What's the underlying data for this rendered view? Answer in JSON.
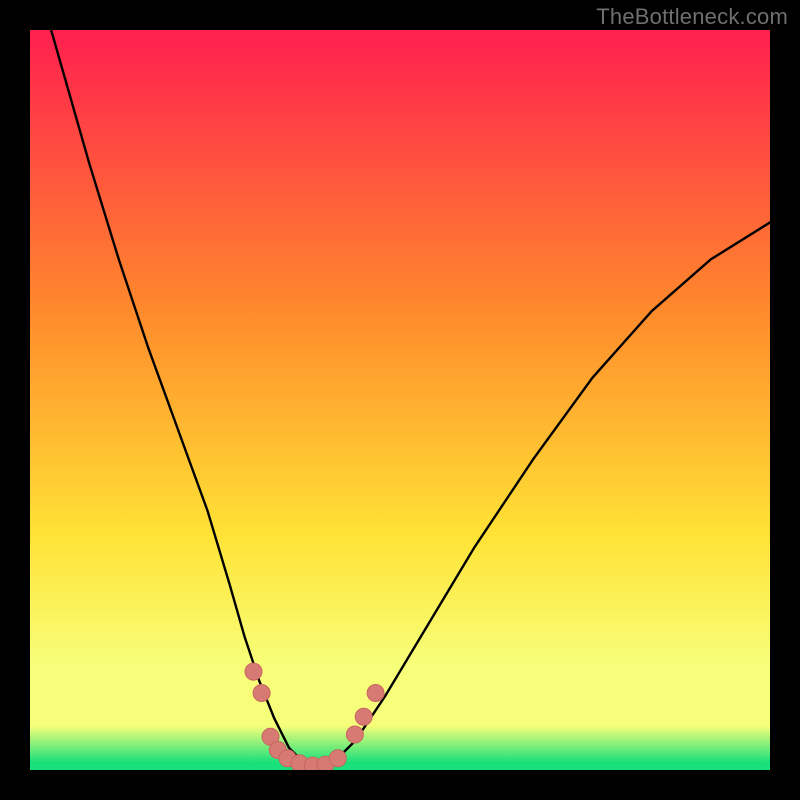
{
  "watermark": "TheBottleneck.com",
  "colors": {
    "bg": "#000000",
    "grad_top": "#ff1f4f",
    "grad_mid1": "#ff8a2b",
    "grad_mid2": "#ffe235",
    "grad_band": "#f7ff7a",
    "grad_bottom": "#18e07a",
    "curve": "#000000",
    "marker_fill": "#d77a74",
    "marker_stroke": "#c9655f"
  },
  "chart_data": {
    "type": "line",
    "title": "",
    "xlabel": "",
    "ylabel": "",
    "xlim": [
      0,
      100
    ],
    "ylim": [
      0,
      100
    ],
    "series": [
      {
        "name": "bottleneck-curve",
        "x": [
          0,
          4,
          8,
          12,
          16,
          20,
          24,
          27,
          29,
          31,
          33,
          35,
          37,
          39,
          41,
          44,
          48,
          54,
          60,
          68,
          76,
          84,
          92,
          100
        ],
        "y": [
          110,
          96,
          82,
          69,
          57,
          46,
          35,
          25,
          18,
          12,
          7,
          3,
          1,
          0.5,
          1,
          4,
          10,
          20,
          30,
          42,
          53,
          62,
          69,
          74
        ]
      }
    ],
    "markers": [
      {
        "x": 30.2,
        "y": 13.3
      },
      {
        "x": 31.3,
        "y": 10.4
      },
      {
        "x": 32.5,
        "y": 4.5
      },
      {
        "x": 33.5,
        "y": 2.7
      },
      {
        "x": 34.8,
        "y": 1.6
      },
      {
        "x": 36.4,
        "y": 0.9
      },
      {
        "x": 38.2,
        "y": 0.6
      },
      {
        "x": 39.9,
        "y": 0.7
      },
      {
        "x": 41.6,
        "y": 1.6
      },
      {
        "x": 43.9,
        "y": 4.8
      },
      {
        "x": 45.1,
        "y": 7.2
      },
      {
        "x": 46.7,
        "y": 10.4
      }
    ],
    "marker_radius_px": 8.5
  }
}
